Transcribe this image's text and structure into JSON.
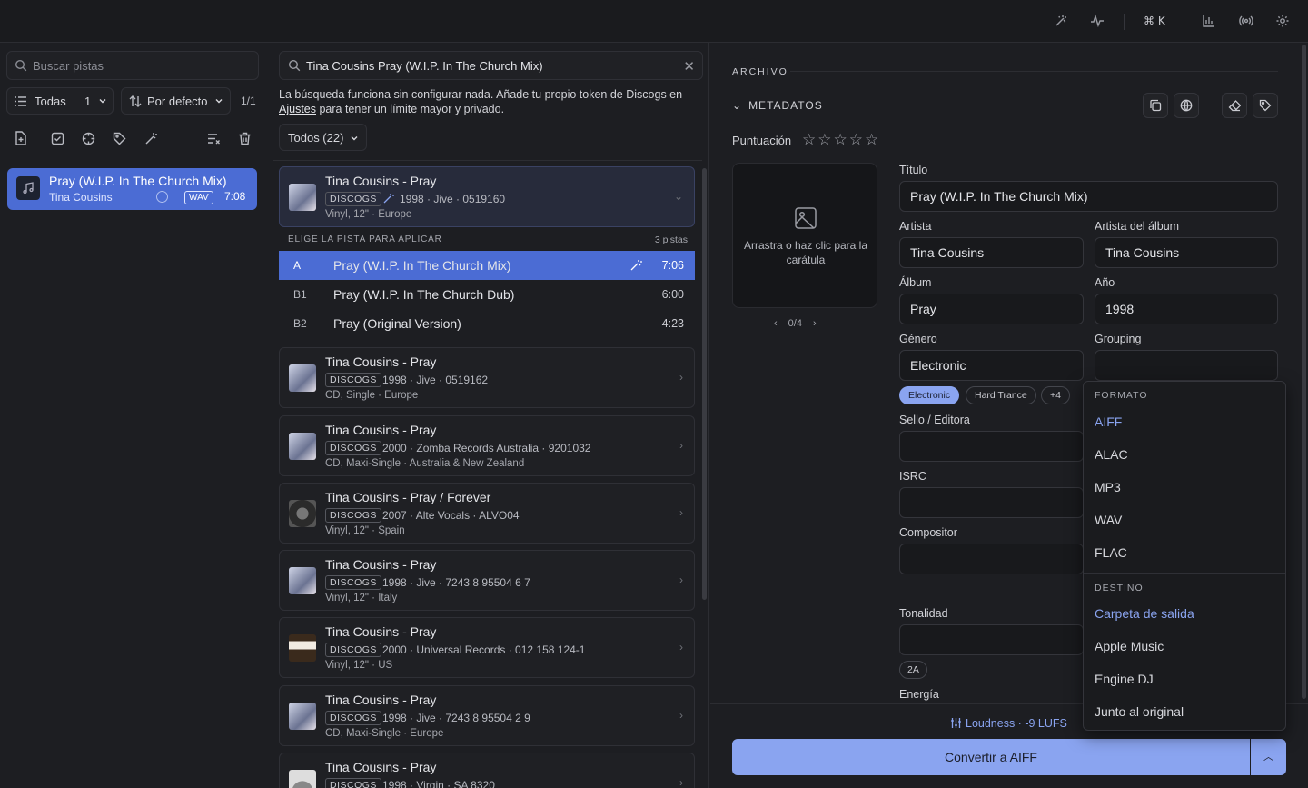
{
  "topbar": {
    "shortcut_label": "⌘ K"
  },
  "left": {
    "search_placeholder": "Buscar pistas",
    "filter_label": "Todas",
    "filter_count": "1",
    "sort_label": "Por defecto",
    "page_label": "1/1",
    "track": {
      "title": "Pray (W.I.P. In The Church Mix)",
      "artist": "Tina Cousins",
      "format": "WAV",
      "duration": "7:08"
    }
  },
  "middle": {
    "search_value": "Tina Cousins Pray (W.I.P. In The Church Mix)",
    "note_before": "La búsqueda funciona sin configurar nada. Añade tu propio token de Discogs en ",
    "note_link": "Ajustes",
    "note_after": " para tener un límite mayor y privado.",
    "filter_label": "Todos (22)",
    "picker_title": "ELIGE LA PISTA PARA APLICAR",
    "picker_count": "3 pistas",
    "selected_release": {
      "title": "Tina Cousins - Pray",
      "source": "DISCOGS",
      "meta": "1998 · Jive · 0519160",
      "details": "Vinyl, 12\" · Europe"
    },
    "picker_rows": [
      {
        "key": "A",
        "name": "Pray (W.I.P. In The Church Mix)",
        "duration": "7:06"
      },
      {
        "key": "B1",
        "name": "Pray (W.I.P. In The Church Dub)",
        "duration": "6:00"
      },
      {
        "key": "B2",
        "name": "Pray (Original Version)",
        "duration": "4:23"
      }
    ],
    "results": [
      {
        "title": "Tina Cousins - Pray",
        "source": "DISCOGS",
        "meta": "1998 · Jive · 0519162",
        "details": "CD, Single · Europe"
      },
      {
        "title": "Tina Cousins - Pray",
        "source": "DISCOGS",
        "meta": "2000 · Zomba Records Australia · 9201032",
        "details": "CD, Maxi-Single · Australia & New Zealand"
      },
      {
        "title": "Tina Cousins - Pray / Forever",
        "source": "DISCOGS",
        "meta": "2007 · Alte Vocals · ALVO04",
        "details": "Vinyl, 12\" · Spain"
      },
      {
        "title": "Tina Cousins - Pray",
        "source": "DISCOGS",
        "meta": "1998 · Jive · 7243 8 95504 6 7",
        "details": "Vinyl, 12\" · Italy"
      },
      {
        "title": "Tina Cousins - Pray",
        "source": "DISCOGS",
        "meta": "2000 · Universal Records · 012 158 124-1",
        "details": "Vinyl, 12\" · US"
      },
      {
        "title": "Tina Cousins - Pray",
        "source": "DISCOGS",
        "meta": "1998 · Jive · 7243 8 95504 2 9",
        "details": "CD, Maxi-Single · Europe"
      },
      {
        "title": "Tina Cousins - Pray",
        "source": "DISCOGS",
        "meta": "1998 · Virgin · SA 8320",
        "details": ""
      }
    ]
  },
  "right": {
    "section_title": "ARCHIVO",
    "metadata_title": "METADATOS",
    "rating_label": "Puntuación",
    "rating_value": 0,
    "rating_stars": "☆☆☆☆☆",
    "cover_hint": "Arrastra o haz clic para la carátula",
    "cover_pager": "0/4",
    "fields": {
      "title_label": "Título",
      "title_value": "Pray (W.I.P. In The Church Mix)",
      "artist_label": "Artista",
      "artist_value": "Tina Cousins",
      "album_artist_label": "Artista del álbum",
      "album_artist_value": "Tina Cousins",
      "album_label": "Álbum",
      "album_value": "Pray",
      "year_label": "Año",
      "year_value": "1998",
      "genre_label": "Género",
      "genre_value": "Electronic",
      "grouping_label": "Grouping",
      "grouping_value": "",
      "label_label": "Sello / Editora",
      "label_value": "",
      "isrc_label": "ISRC",
      "isrc_value": "",
      "composer_label": "Compositor",
      "composer_value": "",
      "key_label": "Tonalidad",
      "key_value": "",
      "energy_label": "Energía"
    },
    "genre_chips": [
      "Electronic",
      "Hard Trance",
      "+4"
    ],
    "key_chip": "2A",
    "loudness": "Loudness · -9 LUFS",
    "convert_label": "Convertir a AIFF"
  },
  "menu": {
    "format_header": "FORMATO",
    "formats": [
      "AIFF",
      "ALAC",
      "MP3",
      "WAV",
      "FLAC"
    ],
    "selected_format": "AIFF",
    "destination_header": "DESTINO",
    "destinations": [
      "Carpeta de salida",
      "Apple Music",
      "Engine DJ",
      "Junto al original"
    ],
    "selected_destination": "Carpeta de salida"
  },
  "colors": {
    "accent": "#4b6cd4",
    "accent_light": "#8aa4f0",
    "background": "#1d1e22"
  }
}
